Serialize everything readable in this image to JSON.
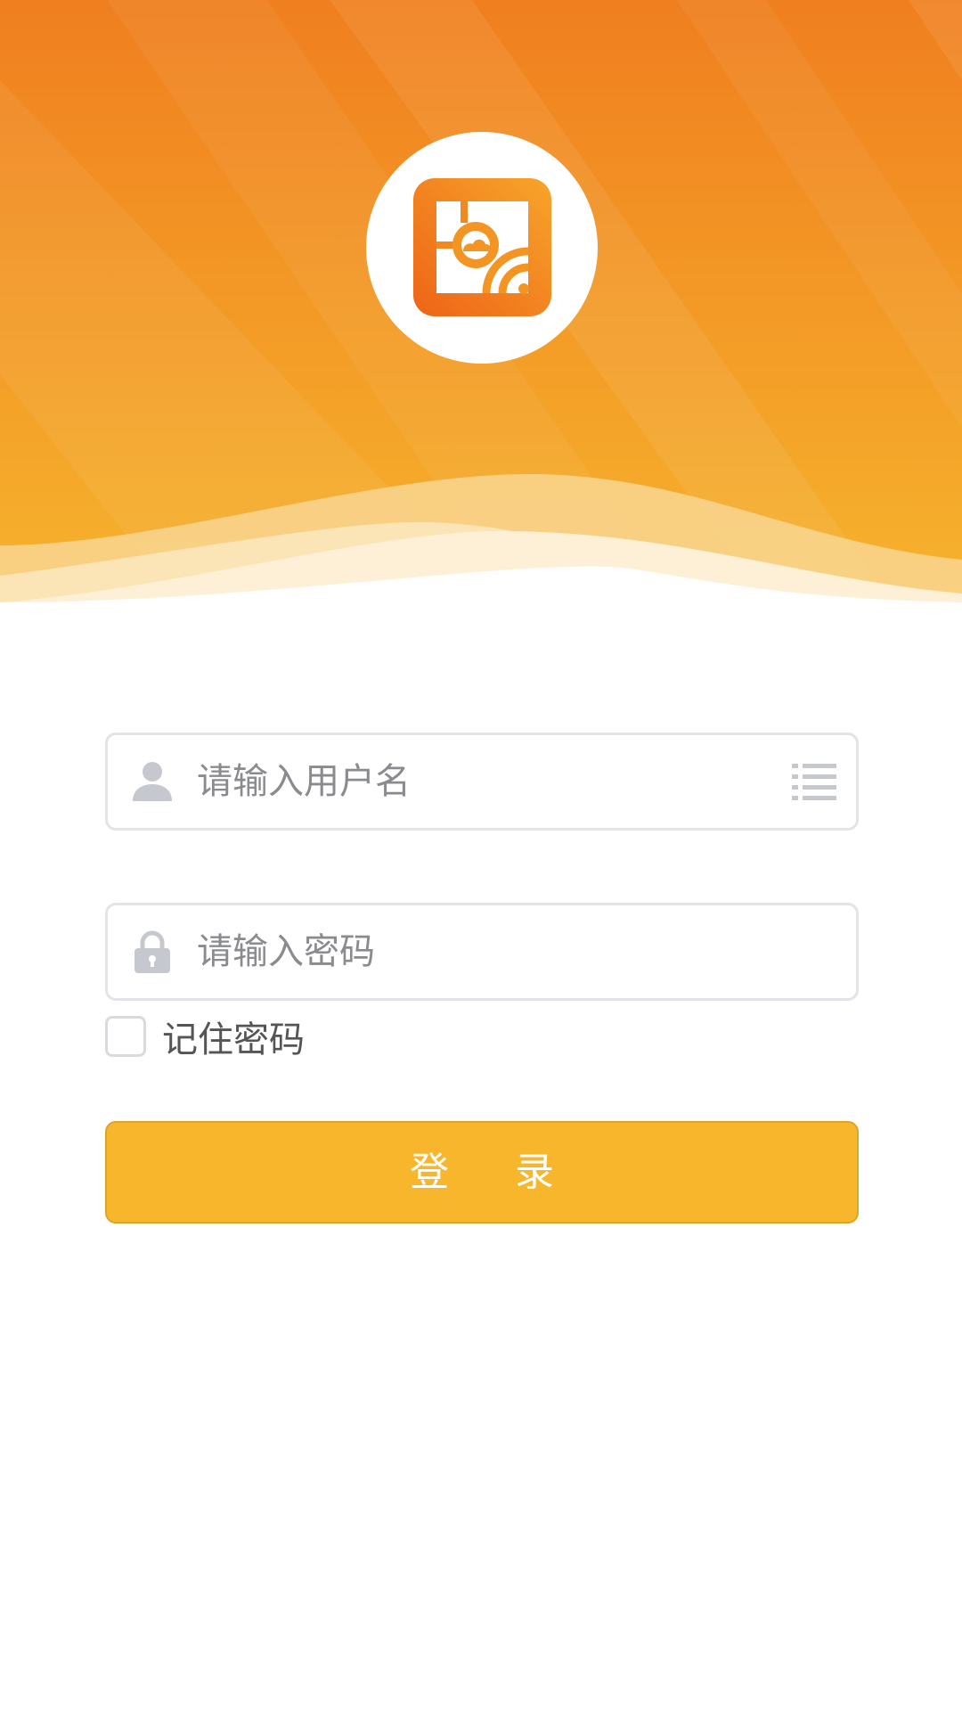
{
  "app": {
    "logo_icon": "cloud-broadcast-logo-icon"
  },
  "login_form": {
    "username_placeholder": "请输入用户名",
    "username_value": "",
    "password_placeholder": "请输入密码",
    "password_value": "",
    "remember_label": "记住密码",
    "remember_checked": false,
    "login_label": "登 录"
  },
  "icons": {
    "username_icon": "user-icon",
    "account_list_icon": "list-icon",
    "password_icon": "lock-icon"
  },
  "colors": {
    "header_gradient_top": "#f07f1f",
    "header_gradient_bottom": "#f6b32d",
    "accent_button": "#f7b62c",
    "input_border": "#e3e4e8",
    "icon_gray": "#c5c8cf",
    "placeholder_text": "#8a8b8f"
  }
}
